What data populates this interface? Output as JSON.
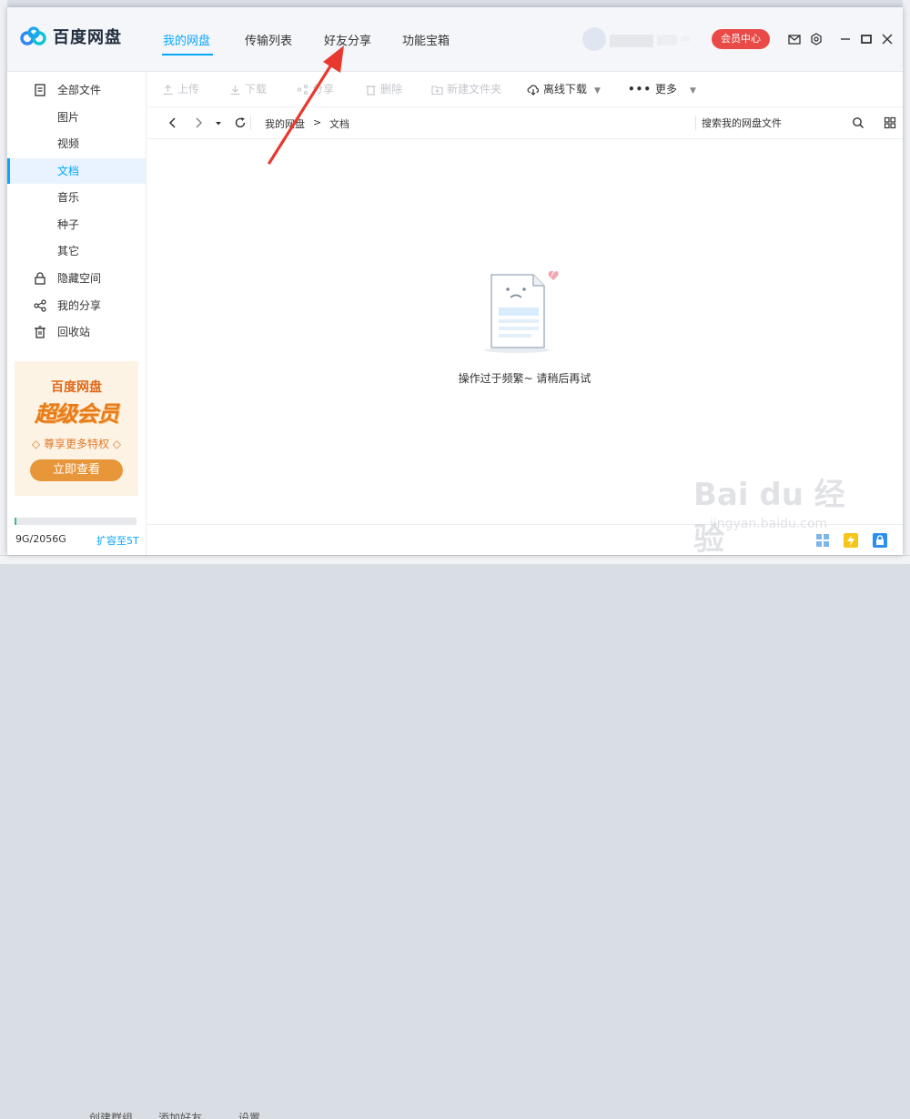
{
  "app": {
    "brand": "百度网盘"
  },
  "nav": {
    "tabs": [
      "我的网盘",
      "传输列表",
      "好友分享",
      "功能宝箱"
    ],
    "active": 0
  },
  "titlebar": {
    "vip_label": "会员中心"
  },
  "sidebar": {
    "items": [
      {
        "label": "全部文件",
        "icon": "file-list-icon"
      },
      {
        "label": "图片"
      },
      {
        "label": "视频"
      },
      {
        "label": "文档"
      },
      {
        "label": "音乐"
      },
      {
        "label": "种子"
      },
      {
        "label": "其它"
      },
      {
        "label": "隐藏空间",
        "icon": "lock-icon"
      },
      {
        "label": "我的分享",
        "icon": "share-icon"
      },
      {
        "label": "回收站",
        "icon": "trash-icon"
      }
    ],
    "active_index": 3
  },
  "promo": {
    "brand": "百度网盘",
    "title": "超级会员",
    "subtitle": "◇ 尊享更多特权 ◇",
    "button": "立即查看"
  },
  "storage": {
    "text": "9G/2056G",
    "used_fraction": 0.0044,
    "expand_label": "扩容至5T"
  },
  "toolbar": {
    "upload": "上传",
    "download": "下载",
    "share": "分享",
    "delete": "删除",
    "new_folder": "新建文件夹",
    "offline_download": "离线下载",
    "more": "更多"
  },
  "address": {
    "crumbs": [
      "我的网盘",
      ">",
      "文档"
    ],
    "search_placeholder": "搜索我的网盘文件"
  },
  "content": {
    "empty_message": "操作过于频繁~ 请稍后再试"
  },
  "background": {
    "bottom_tabs": [
      "创建群组",
      "添加好友",
      "设置"
    ]
  },
  "watermark": {
    "main": "Bai du 经验",
    "sub": "jingyan.baidu.com"
  },
  "colors": {
    "accent": "#06a7ff",
    "vip": "#e94a48",
    "annotation": "#e8392e",
    "storage": "#33c17b"
  }
}
